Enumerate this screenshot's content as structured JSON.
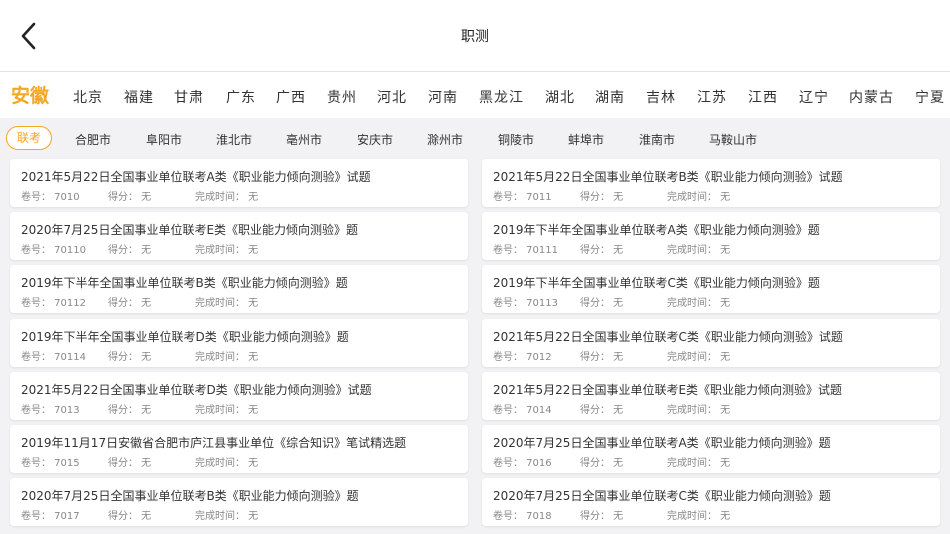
{
  "header": {
    "title": "职测",
    "back_icon": "chevron-left-icon"
  },
  "provinces": [
    "安徽",
    "北京",
    "福建",
    "甘肃",
    "广东",
    "广西",
    "贵州",
    "河北",
    "河南",
    "黑龙江",
    "湖北",
    "湖南",
    "吉林",
    "江苏",
    "江西",
    "辽宁",
    "内蒙古",
    "宁夏"
  ],
  "active_province": "安徽",
  "cities": [
    "联考",
    "合肥市",
    "阜阳市",
    "淮北市",
    "亳州市",
    "安庆市",
    "滁州市",
    "铜陵市",
    "蚌埠市",
    "淮南市",
    "马鞍山市"
  ],
  "active_city": "联考",
  "meta_labels": {
    "id": "卷号：",
    "score": "得分：",
    "time": "完成时间："
  },
  "papers": [
    {
      "title": "2021年5月22日全国事业单位联考A类《职业能力倾向测验》试题",
      "id": "7010",
      "score": "无",
      "time": "无"
    },
    {
      "title": "2021年5月22日全国事业单位联考B类《职业能力倾向测验》试题",
      "id": "7011",
      "score": "无",
      "time": "无"
    },
    {
      "title": "2020年7月25日全国事业单位联考E类《职业能力倾向测验》题",
      "id": "70110",
      "score": "无",
      "time": "无"
    },
    {
      "title": "2019年下半年全国事业单位联考A类《职业能力倾向测验》题",
      "id": "70111",
      "score": "无",
      "time": "无"
    },
    {
      "title": "2019年下半年全国事业单位联考B类《职业能力倾向测验》题",
      "id": "70112",
      "score": "无",
      "time": "无"
    },
    {
      "title": "2019年下半年全国事业单位联考C类《职业能力倾向测验》题",
      "id": "70113",
      "score": "无",
      "time": "无"
    },
    {
      "title": "2019年下半年全国事业单位联考D类《职业能力倾向测验》题",
      "id": "70114",
      "score": "无",
      "time": "无"
    },
    {
      "title": "2021年5月22日全国事业单位联考C类《职业能力倾向测验》试题",
      "id": "7012",
      "score": "无",
      "time": "无"
    },
    {
      "title": "2021年5月22日全国事业单位联考D类《职业能力倾向测验》试题",
      "id": "7013",
      "score": "无",
      "time": "无"
    },
    {
      "title": "2021年5月22日全国事业单位联考E类《职业能力倾向测验》试题",
      "id": "7014",
      "score": "无",
      "time": "无"
    },
    {
      "title": "2019年11月17日安徽省合肥市庐江县事业单位《综合知识》笔试精选题",
      "id": "7015",
      "score": "无",
      "time": "无"
    },
    {
      "title": "2020年7月25日全国事业单位联考A类《职业能力倾向测验》题",
      "id": "7016",
      "score": "无",
      "time": "无"
    },
    {
      "title": "2020年7月25日全国事业单位联考B类《职业能力倾向测验》题",
      "id": "7017",
      "score": "无",
      "time": "无"
    },
    {
      "title": "2020年7月25日全国事业单位联考C类《职业能力倾向测验》题",
      "id": "7018",
      "score": "无",
      "time": "无"
    }
  ],
  "colors": {
    "accent": "#f5a623",
    "background": "#f2f2f4",
    "card": "#ffffff"
  }
}
